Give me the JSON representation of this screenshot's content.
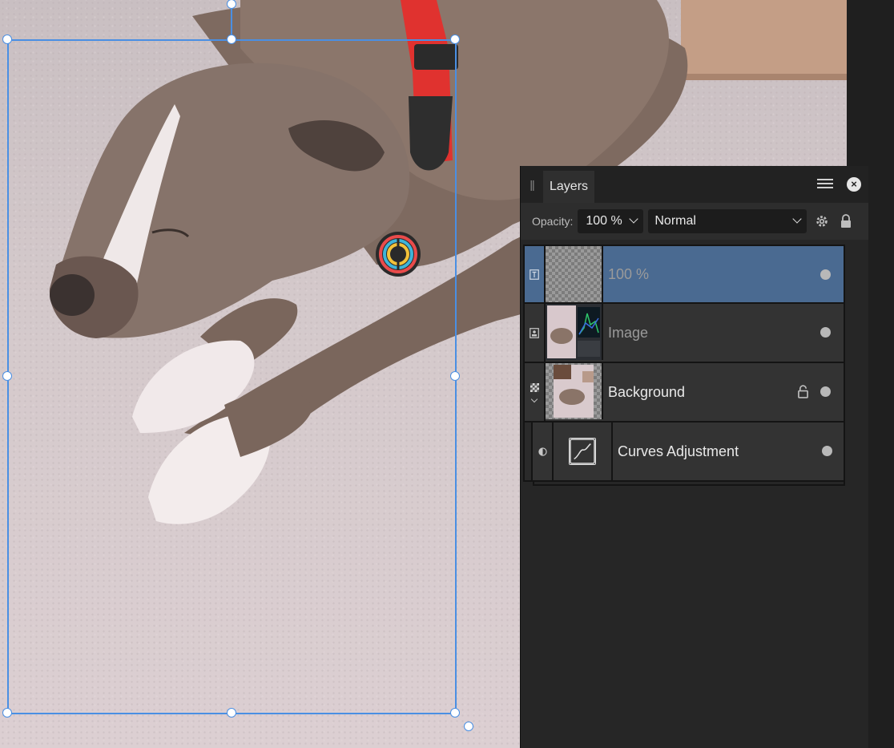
{
  "canvas": {
    "content": "photo of a sleeping brindle dog lying on carpet with red collar and rainbow peace-sign tag"
  },
  "layers_panel": {
    "tab_label": "Layers",
    "opacity_label": "Opacity:",
    "opacity_value": "100 %",
    "blend_mode": "Normal",
    "layers": [
      {
        "name": "100 %",
        "type_icon": "text-layer-icon",
        "selected": true,
        "dimmed": true,
        "locked": false
      },
      {
        "name": "Image",
        "type_icon": "image-layer-icon",
        "selected": false,
        "dimmed": true,
        "locked": false
      },
      {
        "name": "Background",
        "type_icon": "pixel-layer-icon",
        "selected": false,
        "dimmed": false,
        "locked": true,
        "expanded": true
      },
      {
        "name": "Curves Adjustment",
        "type_icon": "adjustment-layer-icon",
        "selected": false,
        "dimmed": false,
        "locked": false,
        "child": true
      }
    ]
  },
  "colors": {
    "selection": "#4a8fe3",
    "selected_row": "#4a6a91",
    "panel_bg": "#262626"
  }
}
